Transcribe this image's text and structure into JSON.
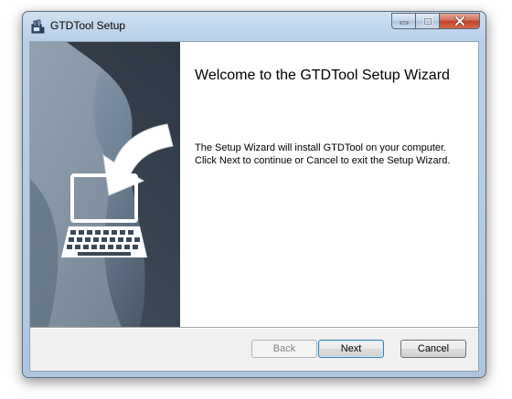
{
  "window": {
    "title": "GTDTool Setup"
  },
  "content": {
    "heading": "Welcome to the GTDTool Setup Wizard",
    "body": "The Setup Wizard will install GTDTool on your computer. Click Next to continue or Cancel to exit the Setup Wizard."
  },
  "buttons": {
    "back_label": "Back",
    "next_label": "Next",
    "cancel_label": "Cancel"
  },
  "icons": {
    "app": "installer-icon",
    "banner": "computer-with-arrow-icon",
    "minimize": "minimize-icon",
    "maximize": "maximize-icon",
    "close": "close-icon"
  },
  "colors": {
    "banner": "#4a5868",
    "close_button": "#c04028",
    "default_button_border": "#3c7fb1"
  }
}
